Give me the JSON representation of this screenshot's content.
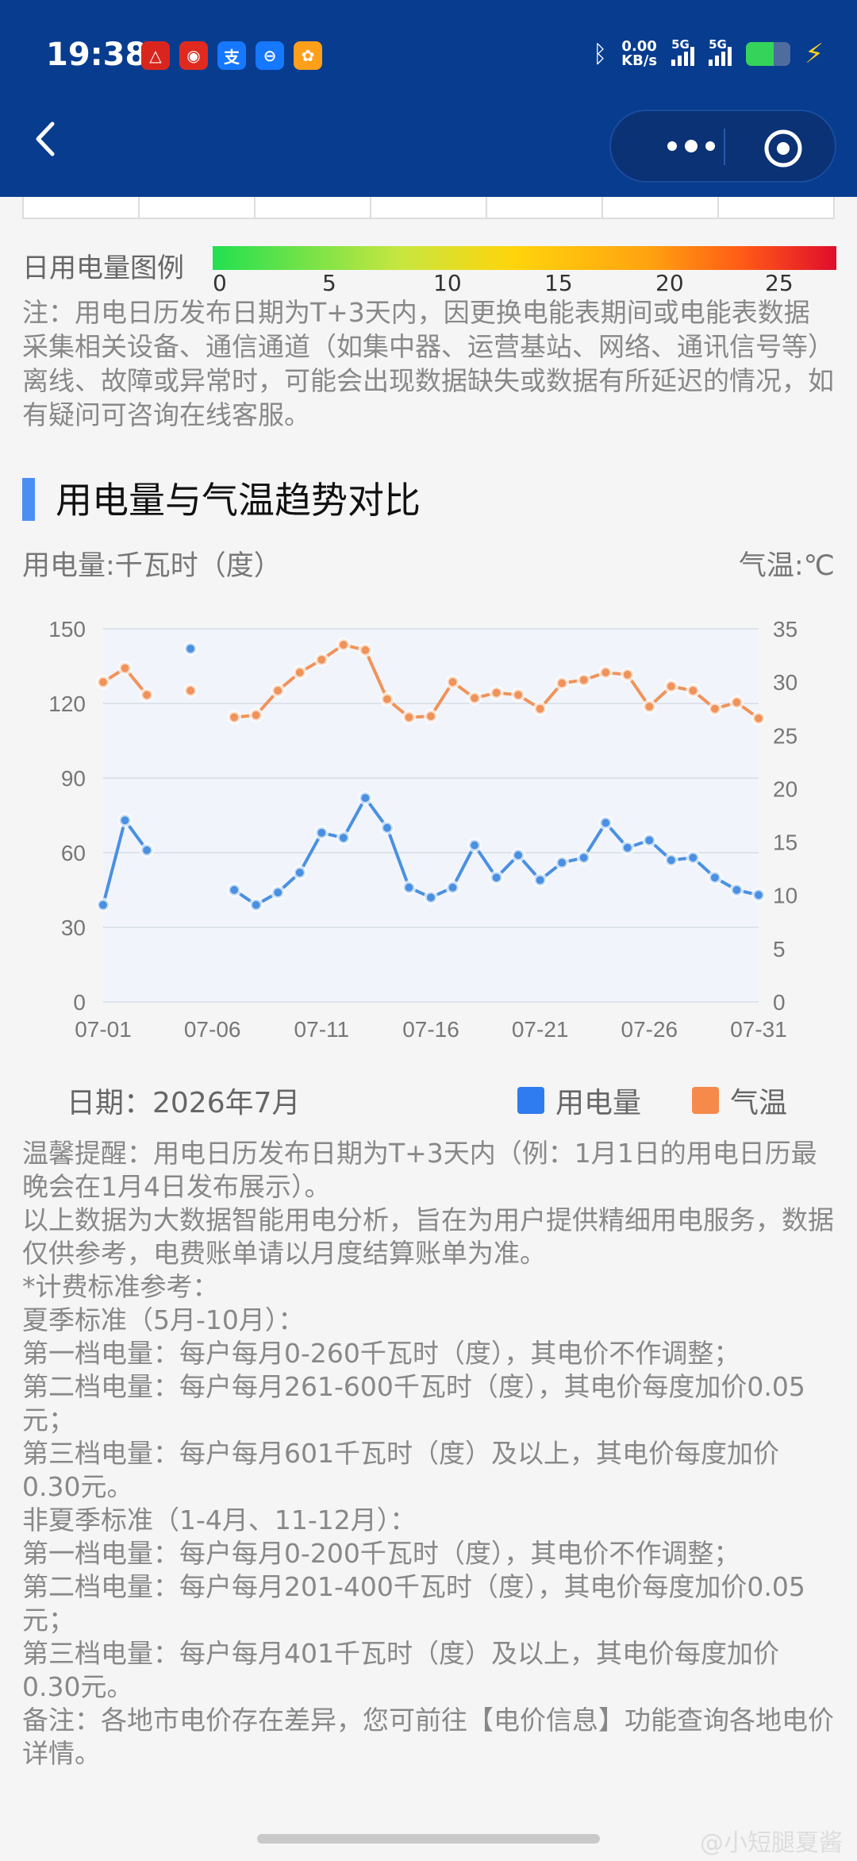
{
  "status_bar": {
    "time": "19:38",
    "apps": [
      {
        "icon": "app-icon-a",
        "color": "#d8261e",
        "glyph": "△"
      },
      {
        "icon": "app-icon-b",
        "color": "#e02a1f",
        "glyph": "◉"
      },
      {
        "icon": "alipay-icon",
        "color": "#1677ff",
        "glyph": "支"
      },
      {
        "icon": "app-icon-c",
        "color": "#1677ff",
        "glyph": "⊖"
      },
      {
        "icon": "app-icon-d",
        "color": "#ff9f1a",
        "glyph": "✿"
      }
    ],
    "net_speed_value": "0.00",
    "net_speed_unit": "KB/s",
    "signal_label": "5G",
    "battery_level": 0.62
  },
  "calendar_legend": {
    "title": "日用电量图例",
    "ticks": [
      "0",
      "5",
      "10",
      "15",
      "20",
      "25"
    ]
  },
  "note": "注：用电日历发布日期为T+3天内，因更换电能表期间或电能表数据采集相关设备、通信通道（如集中器、运营基站、网络、通讯信号等）离线、故障或异常时，可能会出现数据缺失或数据有所延迟的情况，如有疑问可咨询在线客服。",
  "section": {
    "title": "用电量与气温趋势对比",
    "unit_left": "用电量:千瓦时（度）",
    "unit_right": "气温:℃"
  },
  "chart_data": {
    "type": "line",
    "x": [
      "07-01",
      "07-02",
      "07-03",
      "07-04",
      "07-05",
      "07-06",
      "07-07",
      "07-08",
      "07-09",
      "07-10",
      "07-11",
      "07-12",
      "07-13",
      "07-14",
      "07-15",
      "07-16",
      "07-17",
      "07-18",
      "07-19",
      "07-20",
      "07-21",
      "07-22",
      "07-23",
      "07-24",
      "07-25",
      "07-26",
      "07-27",
      "07-28",
      "07-29",
      "07-30",
      "07-31"
    ],
    "x_tick_labels": [
      "07-01",
      "07-06",
      "07-11",
      "07-16",
      "07-21",
      "07-26",
      "07-31"
    ],
    "y_left": {
      "range": [
        0,
        150
      ],
      "ticks": [
        "0",
        "30",
        "60",
        "90",
        "120",
        "150"
      ]
    },
    "y_right": {
      "range": [
        0,
        35
      ],
      "ticks": [
        "0",
        "5",
        "10",
        "15",
        "20",
        "25",
        "30",
        "35"
      ]
    },
    "series": [
      {
        "name": "用电量",
        "axis": "left",
        "color": "#4a90e2",
        "values": [
          39,
          73,
          61,
          null,
          142,
          null,
          45,
          39,
          44,
          52,
          68,
          66,
          82,
          70,
          46,
          42,
          46,
          63,
          50,
          59,
          49,
          56,
          58,
          72,
          62,
          65,
          57,
          58,
          50,
          45,
          43
        ]
      },
      {
        "name": "气温",
        "axis": "right",
        "color": "#f0935a",
        "values": [
          30,
          31.3,
          28.8,
          null,
          29.2,
          null,
          26.7,
          26.9,
          29.2,
          30.9,
          32.1,
          33.5,
          33,
          28.4,
          26.7,
          26.8,
          30,
          28.5,
          29,
          28.8,
          27.5,
          29.9,
          30.2,
          30.9,
          30.7,
          27.7,
          29.6,
          29.2,
          27.5,
          28.1,
          26.6
        ]
      }
    ],
    "grid": true,
    "legend_position": "bottom-right"
  },
  "date_label": "日期：2026年7月",
  "legend_items": [
    "用电量",
    "气温"
  ],
  "tips": [
    "温馨提醒：用电日历发布日期为T+3天内（例：1月1日的用电日历最晚会在1月4日发布展示）。",
    "以上数据为大数据智能用电分析，旨在为用户提供精细用电服务，数据仅供参考，电费账单请以月度结算账单为准。",
    "*计费标准参考：",
    "夏季标准（5月-10月）：",
    "第一档电量：每户每月0-260千瓦时（度），其电价不作调整；",
    "第二档电量：每户每月261-600千瓦时（度），其电价每度加价0.05元；",
    "第三档电量：每户每月601千瓦时（度）及以上，其电价每度加价0.30元。",
    "非夏季标准（1-4月、11-12月）：",
    "第一档电量：每户每月0-200千瓦时（度），其电价不作调整；",
    "第二档电量：每户每月201-400千瓦时（度），其电价每度加价0.05元；",
    "第三档电量：每户每月401千瓦时（度）及以上，其电价每度加价0.30元。",
    "备注：各地市电价存在差异，您可前往【电价信息】功能查询各地电价详情。"
  ],
  "watermark": "@小短腿夏酱",
  "colors": {
    "header": "#073c8f",
    "accent": "#4c8ff2",
    "usage": "#2f7bf0",
    "temp": "#f58a4b"
  }
}
